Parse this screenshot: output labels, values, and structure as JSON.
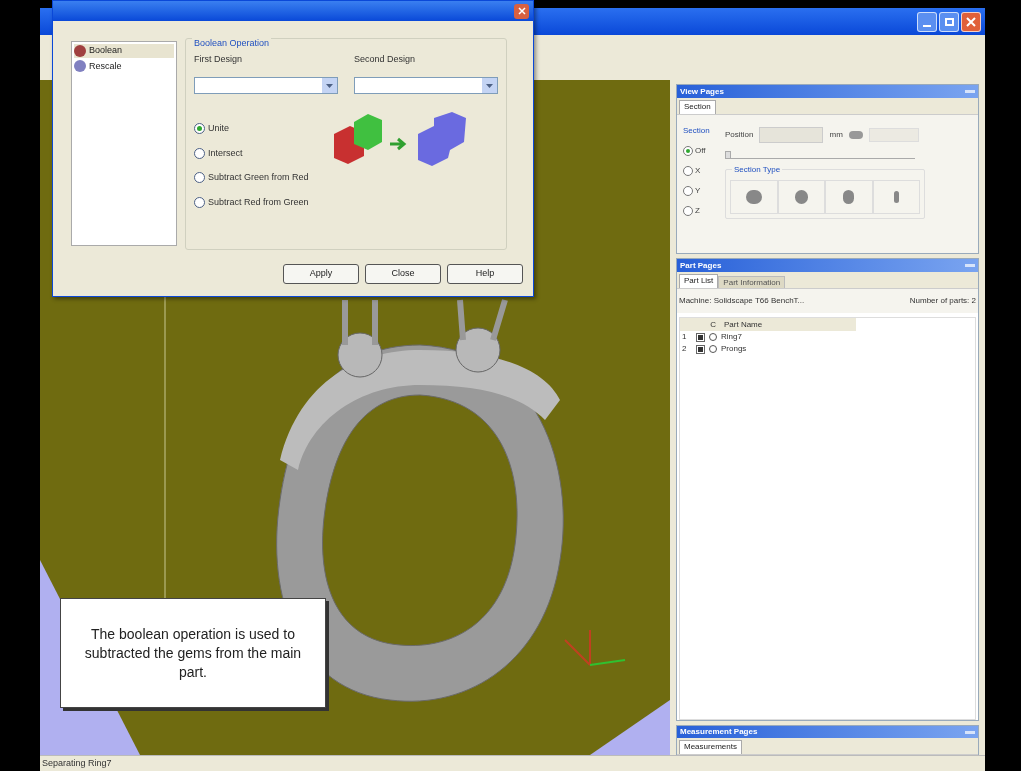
{
  "dialog": {
    "operations": [
      {
        "label": "Boolean",
        "selected": true
      },
      {
        "label": "Rescale",
        "selected": false
      }
    ],
    "group_title": "Boolean Operation",
    "first_design": {
      "label": "First Design"
    },
    "second_design": {
      "label": "Second Design"
    },
    "options": [
      {
        "label": "Unite",
        "selected": true
      },
      {
        "label": "Intersect",
        "selected": false
      },
      {
        "label": "Subtract Green from Red",
        "selected": false
      },
      {
        "label": "Subtract Red from Green",
        "selected": false
      }
    ],
    "buttons": [
      "Apply",
      "Close",
      "Help"
    ]
  },
  "view_pages": {
    "title": "View Pages",
    "tabs": [
      {
        "label": "Section",
        "selected": true
      }
    ],
    "section_group": "Section",
    "section_options": [
      {
        "label": "Off",
        "selected": true
      },
      {
        "label": "X",
        "selected": false
      },
      {
        "label": "Y",
        "selected": false
      },
      {
        "label": "Z",
        "selected": false
      }
    ],
    "position_label": "Position",
    "position_slider": {
      "level": 0
    },
    "unit": "mm",
    "section_type_label": "Section Type"
  },
  "part_pages": {
    "title": "Part Pages",
    "tabs": [
      {
        "label": "Part List",
        "selected": true
      },
      {
        "label": "Part Information",
        "selected": false
      }
    ],
    "machine": "Machine: Solidscape T66 BenchT...",
    "count": "Number of parts: 2",
    "columns": [
      "C",
      "Part Name"
    ],
    "rows": [
      {
        "number": "1",
        "checked": true,
        "name": "Ring7"
      },
      {
        "number": "2",
        "checked": true,
        "name": "Prongs"
      }
    ]
  },
  "measurement_pages": {
    "title": "Measurement Pages",
    "tabs": [
      {
        "label": "Measurements",
        "selected": true
      }
    ]
  },
  "callout": "The boolean operation is used to subtracted the gems from the main part.",
  "status": "Separating Ring7"
}
